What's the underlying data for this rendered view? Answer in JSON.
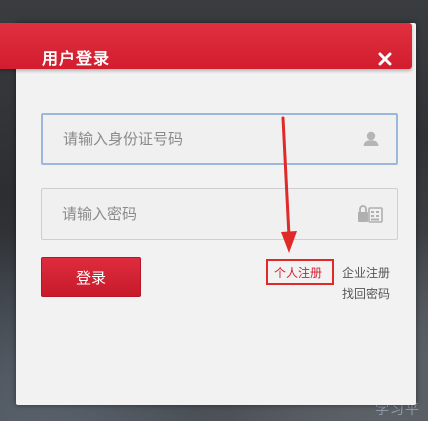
{
  "dialog": {
    "title": "用户登录",
    "close_icon": "close-icon"
  },
  "form": {
    "id_field": {
      "placeholder": "请输入身份证号码",
      "value": "",
      "icon": "user-icon"
    },
    "password_field": {
      "placeholder": "请输入密码",
      "value": "",
      "icon": "keyboard-lock-icon"
    },
    "login_label": "登录"
  },
  "links": {
    "personal_register": "个人注册",
    "enterprise_register": "企业注册",
    "forgot_password": "找回密码"
  },
  "background": {
    "watermark_text": "学习平"
  },
  "colors": {
    "brand_red": "#d21d2f",
    "dialog_bg": "#f2f2f2",
    "focus_border": "#9bb8dc",
    "annotation_red": "#e02a2a"
  }
}
